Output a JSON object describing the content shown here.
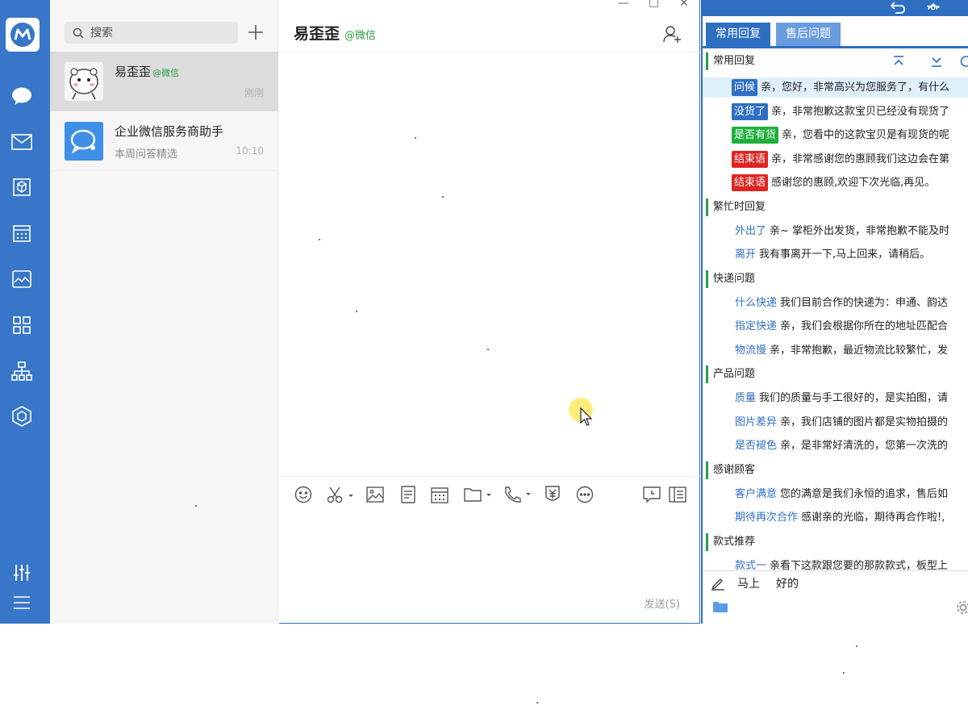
{
  "colors": {
    "rail": "#3776c8",
    "accent": "#2f6fc2",
    "wechat_green": "#2a9d44",
    "tag_green": "#1fb03c",
    "tag_red": "#e0241f"
  },
  "app": {
    "logo": "workwechat-logo-icon"
  },
  "sidebar": {
    "icons": [
      "chat-bubble-icon",
      "mail-icon",
      "cube-box-icon",
      "calendar-icon",
      "image-icon",
      "apps-grid-icon",
      "org-chart-icon",
      "hexagon-app-icon",
      "sliders-icon",
      "menu-icon"
    ]
  },
  "conversations": {
    "search_placeholder": "搜索",
    "items": [
      {
        "name": "易歪歪",
        "source": "@微信",
        "preview": "",
        "time": "刚刚"
      },
      {
        "name": "企业微信服务商助手",
        "source": "",
        "preview": "本周问答精选",
        "time": "10:10"
      }
    ]
  },
  "chat": {
    "contact_name": "易歪歪",
    "contact_source": "@微信",
    "send_label": "发送(S)",
    "toolbar": [
      "emoji-icon",
      "scissors-icon",
      "image-icon",
      "document-icon",
      "calendar-icon",
      "folder-icon",
      "phone-icon",
      "red-packet-icon",
      "more-icon",
      "chat-record-icon",
      "sidebar-panel-icon"
    ]
  },
  "quick_reply": {
    "tabs": [
      "常用回复",
      "售后问题"
    ],
    "top_label": "TOP",
    "groups": [
      {
        "title": "常用回复",
        "items": [
          {
            "tag": "问候",
            "style": "blue",
            "text": "亲，您好，非常高兴为您服务了，有什么"
          },
          {
            "tag": "没货了",
            "style": "blue",
            "text": "亲，非常抱歉这款宝贝已经没有现货了"
          },
          {
            "tag": "是否有货",
            "style": "green",
            "text": "亲，您看中的这款宝贝是有现货的呢"
          },
          {
            "tag": "结束语",
            "style": "red",
            "text": "亲，非常感谢您的惠顾我们这边会在第"
          },
          {
            "tag": "结束语",
            "style": "red",
            "text": "感谢您的惠顾,欢迎下次光临,再见。"
          }
        ]
      },
      {
        "title": "繁忙时回复",
        "items": [
          {
            "tag": "外出了",
            "style": "link",
            "text": "亲~ 掌柜外出发货，非常抱歉不能及时"
          },
          {
            "tag": "离开",
            "style": "link",
            "text": "我有事离开一下,马上回来，请稍后。"
          }
        ]
      },
      {
        "title": "快递问题",
        "items": [
          {
            "tag": "什么快递",
            "style": "link",
            "text": "我们目前合作的快递为：申通、韵达"
          },
          {
            "tag": "指定快递",
            "style": "link",
            "text": "亲，我们会根据你所在的地址匹配合"
          },
          {
            "tag": "物流慢",
            "style": "link",
            "text": "亲，非常抱歉，最近物流比较繁忙，发"
          }
        ]
      },
      {
        "title": "产品问题",
        "items": [
          {
            "tag": "质量",
            "style": "link",
            "text": "我们的质量与手工很好的，是实拍图，请"
          },
          {
            "tag": "图片差异",
            "style": "link",
            "text": "亲，我们店铺的图片都是实物拍摄的"
          },
          {
            "tag": "是否褪色",
            "style": "link",
            "text": "亲，是非常好清洗的，您第一次洗的"
          }
        ]
      },
      {
        "title": "感谢顾客",
        "items": [
          {
            "tag": "客户满意",
            "style": "link",
            "text": "您的满意是我们永恒的追求，售后如"
          },
          {
            "tag": "期待再次合作",
            "style": "link",
            "text": "感谢亲的光临，期待再合作啦!,"
          }
        ]
      },
      {
        "title": "款式推荐",
        "items": [
          {
            "tag": "款式一",
            "style": "link",
            "text": "亲看下这款跟您要的那款款式，板型上"
          }
        ]
      }
    ],
    "quick_words": [
      "马上",
      "好的"
    ]
  }
}
